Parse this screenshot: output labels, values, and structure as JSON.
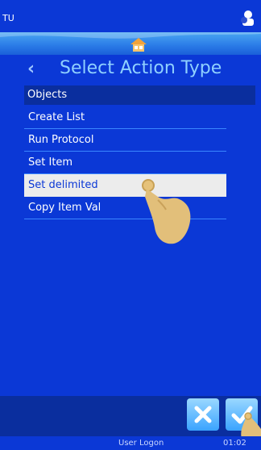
{
  "status": {
    "app": "TU",
    "user_icon": "user-icon"
  },
  "header": {
    "home_icon": "home-icon",
    "back_icon": "back-chevron",
    "title": "Select Action Type"
  },
  "section": {
    "label": "Objects"
  },
  "list": {
    "items": [
      {
        "label": "Create List"
      },
      {
        "label": "Run Protocol"
      },
      {
        "label": "Set Item"
      },
      {
        "label": "Set delimited"
      },
      {
        "label": "Copy Item Val"
      }
    ],
    "selected_index": 3
  },
  "buttons": {
    "cancel_icon": "close-icon",
    "confirm_icon": "checkmark-icon"
  },
  "footer": {
    "left_text": "User Logon",
    "right_text": "01:02"
  },
  "colors": {
    "background": "#0b38d6",
    "header_accent": "#8fd0ff",
    "selected_bg": "#ececec"
  }
}
